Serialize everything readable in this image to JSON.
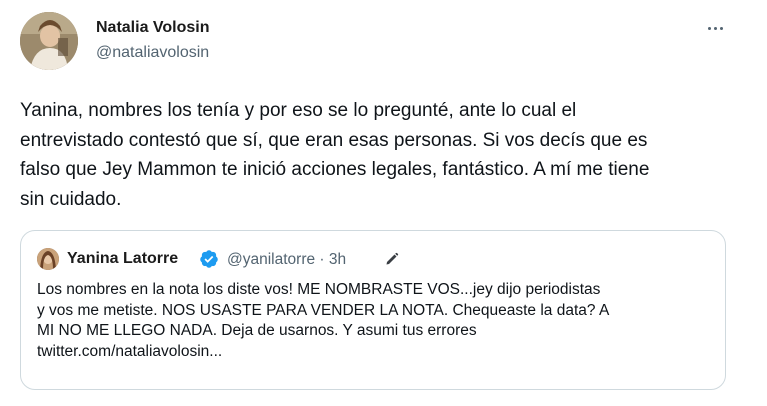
{
  "tweet": {
    "author_name": "Natalia Volosin",
    "author_handle": "@nataliavolosin",
    "text": "Yanina, nombres los tenía y por eso se lo pregunté, ante lo cual el\nentrevistado contestó que sí, que eran esas personas. Si vos decís que es\nfalso que Jey Mammon te inició acciones legales, fantástico. A mí me tiene\nsin cuidado."
  },
  "quoted_tweet": {
    "author_name": "Yanina Latorre",
    "author_handle": "@yanilatorre",
    "separator": "·",
    "time": "3h",
    "text": "Los nombres en la nota los diste vos! ME NOMBRASTE VOS...jey dijo periodistas\ny vos me metiste. NOS USASTE PARA VENDER LA NOTA. Chequeaste la data? A\nMI NO ME LLEGO NADA. Deja de usarnos. Y asumi tus errores\ntwitter.com/nataliavolosin..."
  },
  "icons": {
    "more": "more-horizontal-icon",
    "verified": "verified-badge-icon",
    "edited": "edit-pencil-icon"
  },
  "colors": {
    "verified": "#1d9bf0",
    "secondary_text": "#536471",
    "border": "#cfd9de"
  }
}
